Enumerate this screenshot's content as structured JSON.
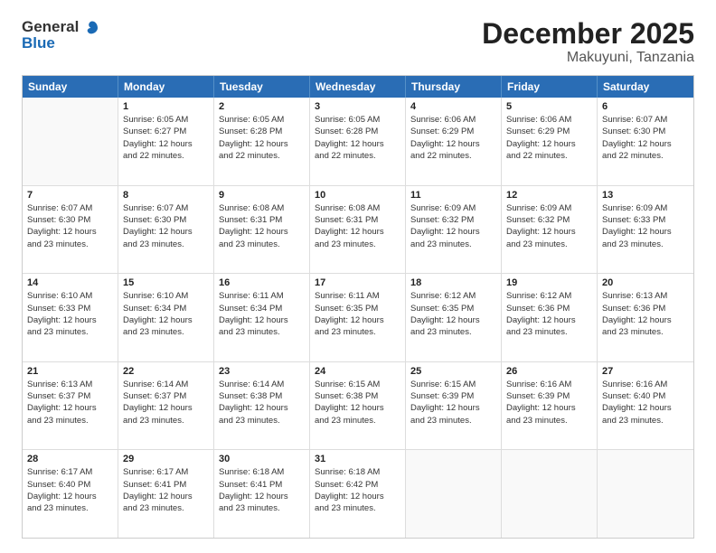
{
  "header": {
    "logo_line1": "General",
    "logo_line2": "Blue",
    "month_year": "December 2025",
    "location": "Makuyuni, Tanzania"
  },
  "days_of_week": [
    "Sunday",
    "Monday",
    "Tuesday",
    "Wednesday",
    "Thursday",
    "Friday",
    "Saturday"
  ],
  "weeks": [
    [
      {
        "day": "",
        "empty": true
      },
      {
        "day": "1",
        "sunrise": "6:05 AM",
        "sunset": "6:27 PM",
        "daylight": "12 hours and 22 minutes."
      },
      {
        "day": "2",
        "sunrise": "6:05 AM",
        "sunset": "6:28 PM",
        "daylight": "12 hours and 22 minutes."
      },
      {
        "day": "3",
        "sunrise": "6:05 AM",
        "sunset": "6:28 PM",
        "daylight": "12 hours and 22 minutes."
      },
      {
        "day": "4",
        "sunrise": "6:06 AM",
        "sunset": "6:29 PM",
        "daylight": "12 hours and 22 minutes."
      },
      {
        "day": "5",
        "sunrise": "6:06 AM",
        "sunset": "6:29 PM",
        "daylight": "12 hours and 22 minutes."
      },
      {
        "day": "6",
        "sunrise": "6:07 AM",
        "sunset": "6:30 PM",
        "daylight": "12 hours and 22 minutes."
      }
    ],
    [
      {
        "day": "7",
        "sunrise": "6:07 AM",
        "sunset": "6:30 PM",
        "daylight": "12 hours and 23 minutes."
      },
      {
        "day": "8",
        "sunrise": "6:07 AM",
        "sunset": "6:30 PM",
        "daylight": "12 hours and 23 minutes."
      },
      {
        "day": "9",
        "sunrise": "6:08 AM",
        "sunset": "6:31 PM",
        "daylight": "12 hours and 23 minutes."
      },
      {
        "day": "10",
        "sunrise": "6:08 AM",
        "sunset": "6:31 PM",
        "daylight": "12 hours and 23 minutes."
      },
      {
        "day": "11",
        "sunrise": "6:09 AM",
        "sunset": "6:32 PM",
        "daylight": "12 hours and 23 minutes."
      },
      {
        "day": "12",
        "sunrise": "6:09 AM",
        "sunset": "6:32 PM",
        "daylight": "12 hours and 23 minutes."
      },
      {
        "day": "13",
        "sunrise": "6:09 AM",
        "sunset": "6:33 PM",
        "daylight": "12 hours and 23 minutes."
      }
    ],
    [
      {
        "day": "14",
        "sunrise": "6:10 AM",
        "sunset": "6:33 PM",
        "daylight": "12 hours and 23 minutes."
      },
      {
        "day": "15",
        "sunrise": "6:10 AM",
        "sunset": "6:34 PM",
        "daylight": "12 hours and 23 minutes."
      },
      {
        "day": "16",
        "sunrise": "6:11 AM",
        "sunset": "6:34 PM",
        "daylight": "12 hours and 23 minutes."
      },
      {
        "day": "17",
        "sunrise": "6:11 AM",
        "sunset": "6:35 PM",
        "daylight": "12 hours and 23 minutes."
      },
      {
        "day": "18",
        "sunrise": "6:12 AM",
        "sunset": "6:35 PM",
        "daylight": "12 hours and 23 minutes."
      },
      {
        "day": "19",
        "sunrise": "6:12 AM",
        "sunset": "6:36 PM",
        "daylight": "12 hours and 23 minutes."
      },
      {
        "day": "20",
        "sunrise": "6:13 AM",
        "sunset": "6:36 PM",
        "daylight": "12 hours and 23 minutes."
      }
    ],
    [
      {
        "day": "21",
        "sunrise": "6:13 AM",
        "sunset": "6:37 PM",
        "daylight": "12 hours and 23 minutes."
      },
      {
        "day": "22",
        "sunrise": "6:14 AM",
        "sunset": "6:37 PM",
        "daylight": "12 hours and 23 minutes."
      },
      {
        "day": "23",
        "sunrise": "6:14 AM",
        "sunset": "6:38 PM",
        "daylight": "12 hours and 23 minutes."
      },
      {
        "day": "24",
        "sunrise": "6:15 AM",
        "sunset": "6:38 PM",
        "daylight": "12 hours and 23 minutes."
      },
      {
        "day": "25",
        "sunrise": "6:15 AM",
        "sunset": "6:39 PM",
        "daylight": "12 hours and 23 minutes."
      },
      {
        "day": "26",
        "sunrise": "6:16 AM",
        "sunset": "6:39 PM",
        "daylight": "12 hours and 23 minutes."
      },
      {
        "day": "27",
        "sunrise": "6:16 AM",
        "sunset": "6:40 PM",
        "daylight": "12 hours and 23 minutes."
      }
    ],
    [
      {
        "day": "28",
        "sunrise": "6:17 AM",
        "sunset": "6:40 PM",
        "daylight": "12 hours and 23 minutes."
      },
      {
        "day": "29",
        "sunrise": "6:17 AM",
        "sunset": "6:41 PM",
        "daylight": "12 hours and 23 minutes."
      },
      {
        "day": "30",
        "sunrise": "6:18 AM",
        "sunset": "6:41 PM",
        "daylight": "12 hours and 23 minutes."
      },
      {
        "day": "31",
        "sunrise": "6:18 AM",
        "sunset": "6:42 PM",
        "daylight": "12 hours and 23 minutes."
      },
      {
        "day": "",
        "empty": true
      },
      {
        "day": "",
        "empty": true
      },
      {
        "day": "",
        "empty": true
      }
    ]
  ],
  "labels": {
    "sunrise_prefix": "Sunrise: ",
    "sunset_prefix": "Sunset: ",
    "daylight_prefix": "Daylight: "
  }
}
